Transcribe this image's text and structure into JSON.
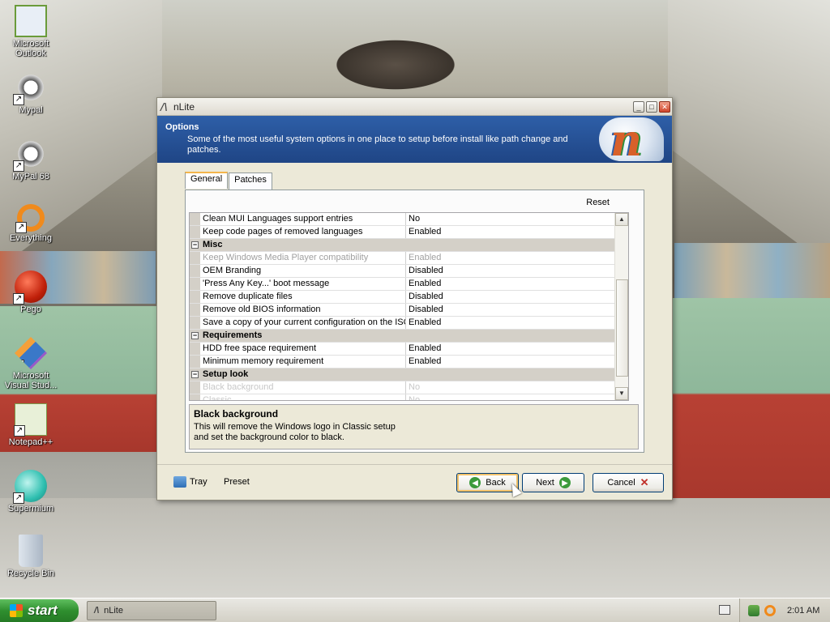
{
  "desktop": {
    "icons": [
      {
        "label": "Microsoft\nOutlook",
        "icon": "outlook-icon"
      },
      {
        "label": "Mypal",
        "icon": "raccoon-icon"
      },
      {
        "label": "MyPal 68",
        "icon": "raccoon-icon"
      },
      {
        "label": "Everything",
        "icon": "magnifier-ring-icon"
      },
      {
        "label": "Pego",
        "icon": "red-ball-icon"
      },
      {
        "label": "Microsoft\nVisual Stud...",
        "icon": "visual-studio-icon"
      },
      {
        "label": "Notepad++",
        "icon": "notepad-icon"
      },
      {
        "label": "Supermium",
        "icon": "browser-icon"
      },
      {
        "label": "Recycle Bin",
        "icon": "recycle-bin-icon"
      }
    ]
  },
  "window": {
    "title": "nLite",
    "header_title": "Options",
    "header_desc": "Some of the most useful system options in one place to setup before install like path change and patches.",
    "tabs": [
      {
        "label": "General",
        "active": true
      },
      {
        "label": "Patches",
        "active": false
      }
    ],
    "reset_label": "Reset",
    "rows": [
      {
        "type": "item",
        "name": "Clean MUI Languages support entries",
        "value": "No",
        "state": "normal"
      },
      {
        "type": "item",
        "name": "Keep code pages of removed languages",
        "value": "Enabled",
        "state": "normal"
      },
      {
        "type": "category",
        "name": "Misc"
      },
      {
        "type": "item",
        "name": "Keep Windows Media Player compatibility",
        "value": "Enabled",
        "state": "disabled"
      },
      {
        "type": "item",
        "name": "OEM Branding",
        "value": "Disabled",
        "state": "normal"
      },
      {
        "type": "item",
        "name": "'Press Any Key...' boot message",
        "value": "Enabled",
        "state": "normal"
      },
      {
        "type": "item",
        "name": "Remove duplicate files",
        "value": "Disabled",
        "state": "normal"
      },
      {
        "type": "item",
        "name": "Remove old BIOS information",
        "value": "Disabled",
        "state": "normal"
      },
      {
        "type": "item",
        "name": "Save a copy of your current configuration on the ISO",
        "value": "Enabled",
        "state": "normal"
      },
      {
        "type": "category",
        "name": "Requirements"
      },
      {
        "type": "item",
        "name": "HDD free space requirement",
        "value": "Enabled",
        "state": "normal"
      },
      {
        "type": "item",
        "name": "Minimum memory requirement",
        "value": "Enabled",
        "state": "normal"
      },
      {
        "type": "category",
        "name": "Setup look"
      },
      {
        "type": "item",
        "name": "Black background",
        "value": "No",
        "state": "dim"
      },
      {
        "type": "item",
        "name": "Classic",
        "value": "No",
        "state": "dim"
      }
    ],
    "desc_title": "Black background",
    "desc_text": "This will remove the Windows logo in Classic setup\nand set the background color to black.",
    "tray_label": "Tray",
    "preset_label": "Preset",
    "back_label": "Back",
    "next_label": "Next",
    "cancel_label": "Cancel"
  },
  "taskbar": {
    "start_label": "start",
    "task_label": "nLite",
    "clock": "2:01 AM"
  },
  "colors": {
    "header_bg": "#2c5aa0",
    "start_green": "#2f8f2f"
  }
}
